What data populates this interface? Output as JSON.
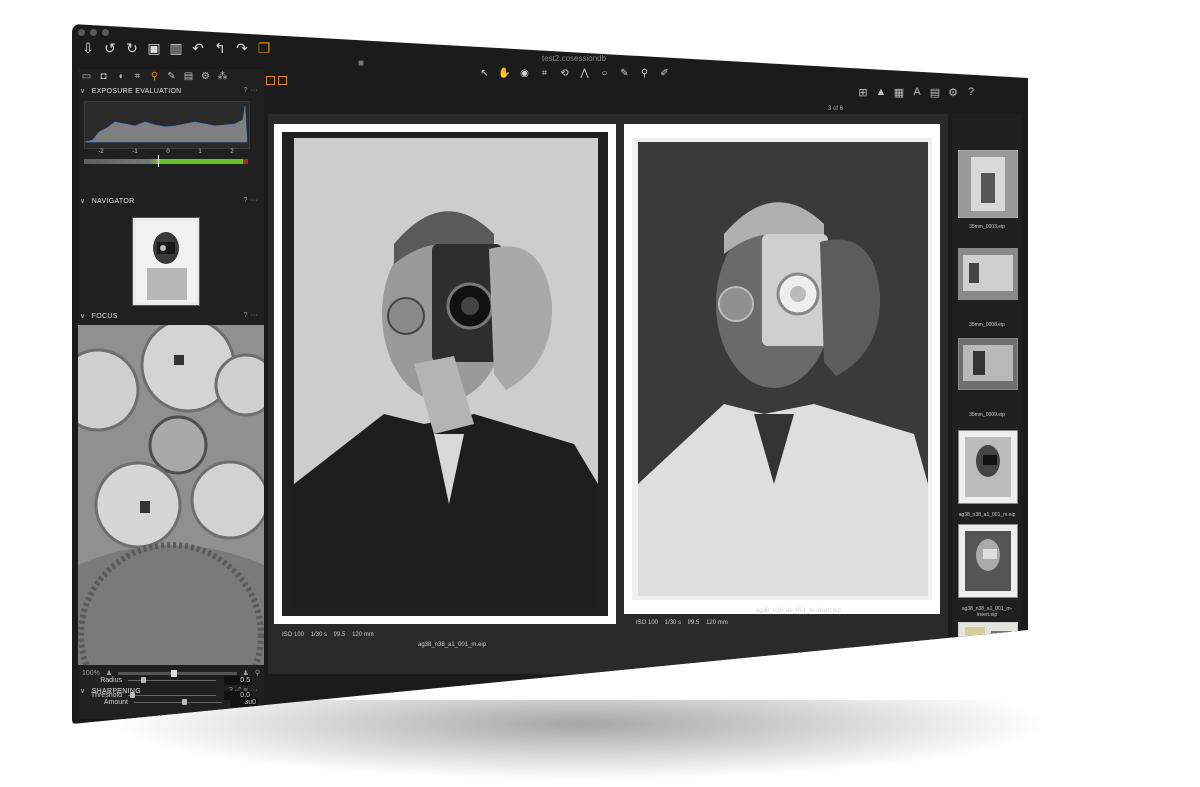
{
  "window": {
    "title": "test2.cosessiondb"
  },
  "toolbar": {
    "icons": [
      "import-icon",
      "rotate-left-icon",
      "rotate-right-icon",
      "tag-icon",
      "trash-icon",
      "undo-icon",
      "undo-back-icon",
      "redo-icon",
      "stack-icon"
    ]
  },
  "left_panel": {
    "exposure": {
      "title": "EXPOSURE EVALUATION",
      "ticks": [
        "-2",
        "-1",
        "0",
        "1",
        "2"
      ]
    },
    "navigator": {
      "title": "NAVIGATOR"
    },
    "focus": {
      "title": "FOCUS",
      "zoom": "100%"
    },
    "sharpening": {
      "title": "SHARPENING",
      "rows": [
        {
          "label": "Amount",
          "value": "300"
        },
        {
          "label": "Radius",
          "value": "0.5"
        },
        {
          "label": "Threshold",
          "value": "0.0"
        }
      ],
      "amount_level": 0.55,
      "radius_level": 0.15,
      "threshold_level": 0.02
    }
  },
  "viewer": {
    "counter": "3 of 6",
    "images": [
      {
        "iso": "ISO 100",
        "shutter": "1/30 s",
        "aperture": "f/9.5",
        "focal": "120 mm",
        "filename": "ag38_n38_a1_001_m.eip"
      },
      {
        "iso": "ISO 100",
        "shutter": "1/30 s",
        "aperture": "f/9.5",
        "focal": "120 mm",
        "filename": "ag38_n38_a1_001_m-invert.eip"
      }
    ]
  },
  "filmstrip": {
    "items": [
      {
        "label": "35mm_0003.eip"
      },
      {
        "label": "35mm_0008.eip"
      },
      {
        "label": "35mm_0009.eip"
      },
      {
        "label": "ag38_n38_a1_001_m.eip"
      },
      {
        "label": "ag38_n38_a1_001_m-invert.eip"
      }
    ]
  }
}
